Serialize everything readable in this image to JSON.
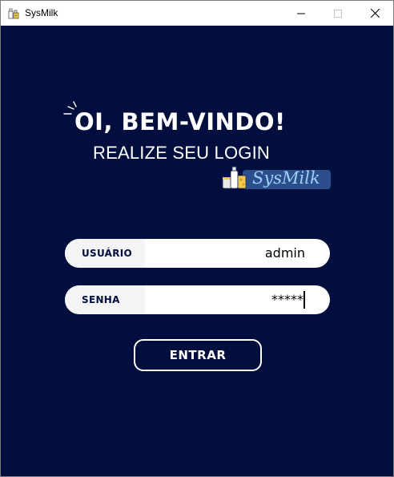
{
  "window": {
    "title": "SysMilk",
    "app_icon": "milk-bottles-icon",
    "controls": {
      "minimize_icon": "minimize-icon",
      "maximize_icon": "maximize-icon",
      "close_icon": "close-icon"
    }
  },
  "hero": {
    "headline": "OI, BEM-VINDO!",
    "subheadline": "REALIZE SEU LOGIN",
    "logo_text": "SysMilk",
    "logo_icon": "milk-products-icon"
  },
  "form": {
    "username": {
      "label": "USUÁRIO",
      "value": "admin"
    },
    "password": {
      "label": "SENHA",
      "value": "*****"
    },
    "submit_label": "ENTRAR"
  },
  "colors": {
    "background": "#020f3e",
    "field_bg": "#ffffff",
    "label_color": "#020f3e",
    "logo_badge": "#2d4e8c",
    "logo_text": "#9ad2f4",
    "button_border": "#ffffff"
  }
}
